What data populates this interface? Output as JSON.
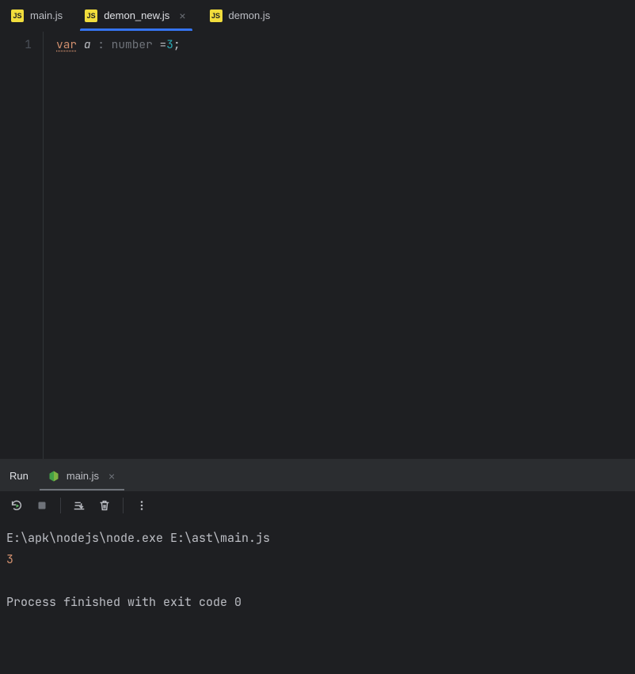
{
  "editor": {
    "tabs": [
      {
        "label": "main.js",
        "active": false,
        "hasClose": false
      },
      {
        "label": "demon_new.js",
        "active": true,
        "hasClose": true
      },
      {
        "label": "demon.js",
        "active": false,
        "hasClose": false
      }
    ],
    "gutter": [
      "1"
    ],
    "code": {
      "keyword": "var",
      "varname": "a",
      "typeann": ": number",
      "eq": " =",
      "num": "3",
      "end": ";"
    }
  },
  "run": {
    "title": "Run",
    "tab": {
      "label": "main.js"
    },
    "console": {
      "cmd": "E:\\apk\\nodejs\\node.exe E:\\ast\\main.js",
      "output": "3",
      "processMsg": "Process finished with exit code 0"
    }
  }
}
